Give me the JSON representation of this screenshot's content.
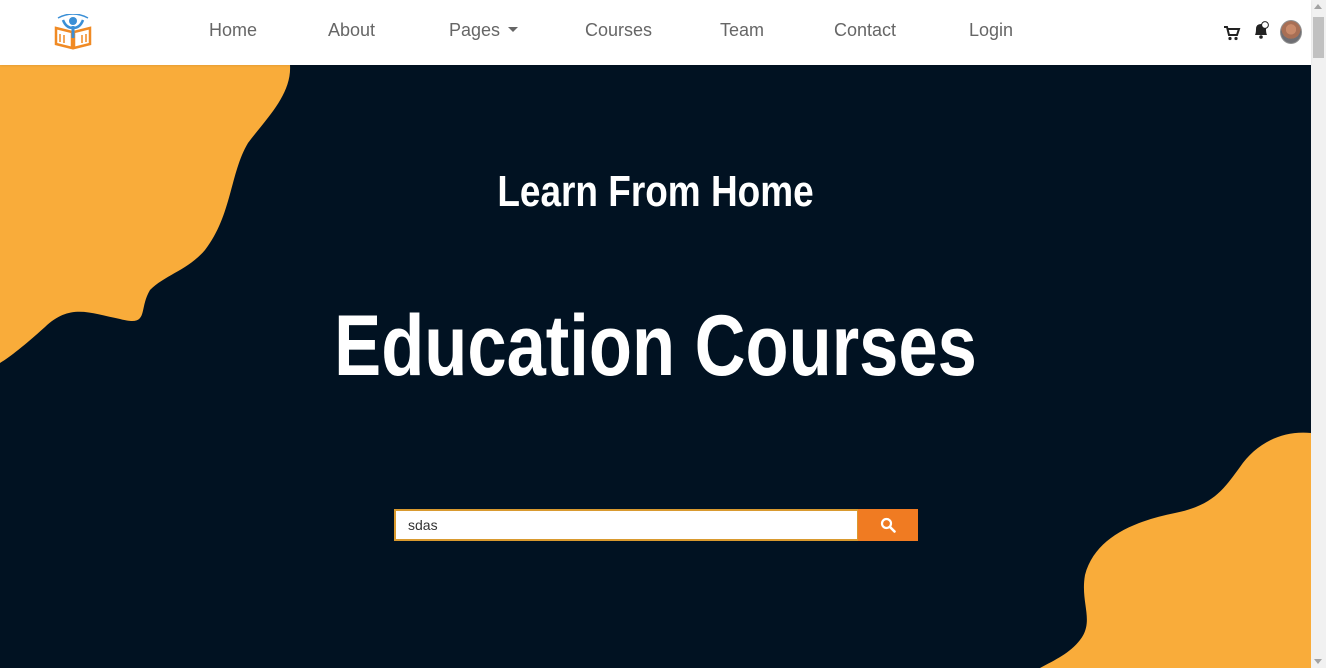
{
  "navbar": {
    "logo": "book-person-logo",
    "items": [
      {
        "label": "Home"
      },
      {
        "label": "About"
      },
      {
        "label": "Pages",
        "has_dropdown": true
      },
      {
        "label": "Courses"
      },
      {
        "label": "Team"
      },
      {
        "label": "Contact"
      },
      {
        "label": "Login"
      }
    ],
    "icons": [
      "cart-icon",
      "bell-icon",
      "avatar"
    ]
  },
  "hero": {
    "subtitle": "Learn From Home",
    "title": "Education Courses",
    "search": {
      "value": "sdas",
      "button_icon": "search-icon"
    }
  },
  "colors": {
    "hero_background": "#011222",
    "blob": "#f9ac3a",
    "search_button": "#f07b22",
    "search_border": "#d99a2f",
    "nav_text": "#666666"
  }
}
